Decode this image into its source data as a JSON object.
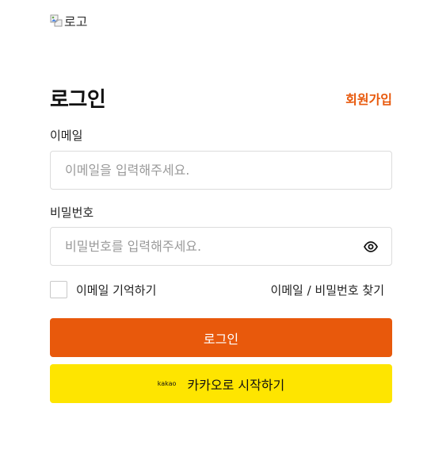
{
  "logo": {
    "alt_text": "로고"
  },
  "header": {
    "title": "로그인",
    "signup_label": "회원가입"
  },
  "email": {
    "label": "이메일",
    "placeholder": "이메일을 입력해주세요."
  },
  "password": {
    "label": "비밀번호",
    "placeholder": "비밀번호를 입력해주세요.",
    "toggle_icon": "eye-icon"
  },
  "options": {
    "remember_label": "이메일 기억하기",
    "remember_checked": false,
    "find_label": "이메일 / 비밀번호 찾기"
  },
  "buttons": {
    "login_label": "로그인",
    "kakao_logo_text": "kakao",
    "kakao_label": "카카오로 시작하기"
  },
  "colors": {
    "accent": "#e8590c",
    "kakao_yellow": "#fee500",
    "border": "#dcdcdc"
  }
}
